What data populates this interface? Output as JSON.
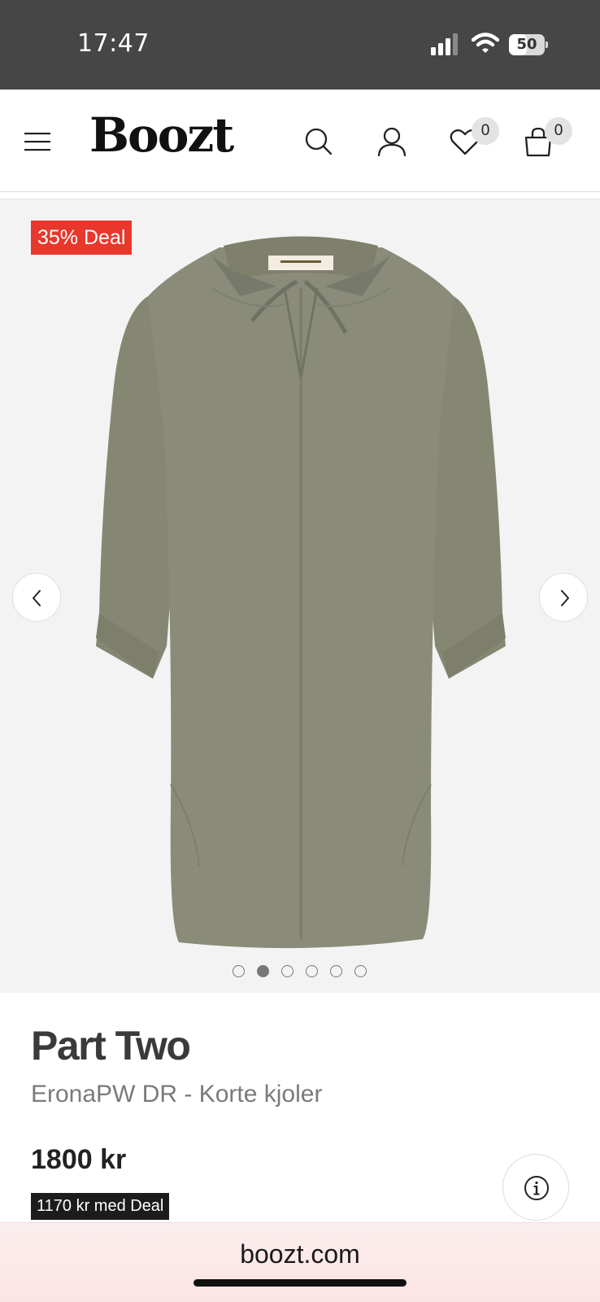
{
  "status_bar": {
    "time": "17:47",
    "battery_percent": "50",
    "battery_level": 0.5
  },
  "header": {
    "logo": "Boozt",
    "wishlist_count": "0",
    "cart_count": "0"
  },
  "gallery": {
    "deal_tag": "35% Deal",
    "image_count": 6,
    "active_image": 2
  },
  "product": {
    "brand": "Part Two",
    "name": "EronaPW DR - Korte kjoler",
    "price": "1800 kr",
    "deal_price": "1170 kr med Deal"
  },
  "browser": {
    "url": "boozt.com"
  },
  "colors": {
    "status_bar_bg": "#464646",
    "deal_red": "#e8372c",
    "dress_khaki": "#8a8c79",
    "gallery_bg": "#f3f3f3"
  },
  "icons": [
    "menu-icon",
    "search-icon",
    "user-icon",
    "heart-icon",
    "bag-icon",
    "chevron-left-icon",
    "chevron-right-icon",
    "info-icon",
    "signal-icon",
    "wifi-icon",
    "battery-icon"
  ]
}
